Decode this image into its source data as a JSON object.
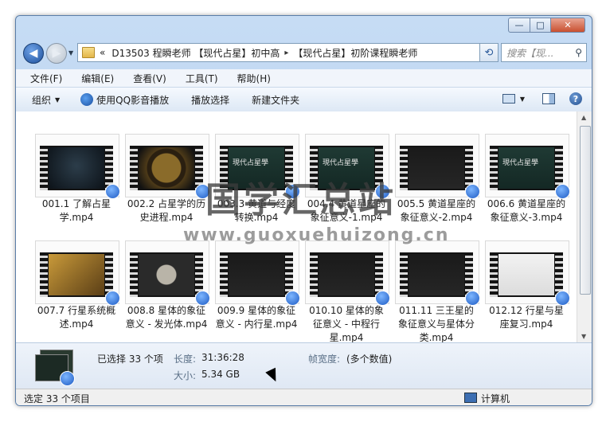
{
  "window": {
    "buttons": {
      "min": "—",
      "max": "□",
      "close": "✕"
    }
  },
  "nav": {
    "back_icon": "back-arrow-icon",
    "forward_icon": "forward-arrow-icon",
    "address": {
      "prefix": "«",
      "crumbs": [
        "D13503 程瞬老师 【现代占星】初中高",
        "【现代占星】初阶课程瞬老师"
      ],
      "sep": "▸"
    },
    "search_placeholder": "搜索【现...",
    "refresh_icon": "refresh-icon"
  },
  "menu": [
    "文件(F)",
    "编辑(E)",
    "查看(V)",
    "工具(T)",
    "帮助(H)"
  ],
  "toolbar": {
    "organize": "组织",
    "play_qq": "使用QQ影音播放",
    "play_selected": "播放选择",
    "new_folder": "新建文件夹"
  },
  "files": [
    {
      "label": "001.1 了解占星学.mp4",
      "scene": "astrology"
    },
    {
      "label": "002.2 占星学的历史进程.mp4",
      "scene": "wheel"
    },
    {
      "label": "003.3 黄道与经度转换.mp4",
      "scene": "title"
    },
    {
      "label": "004.4 黄道星座的象征意义-1.mp4",
      "scene": "title"
    },
    {
      "label": "005.5 黄道星座的象征意义-2.mp4",
      "scene": "text"
    },
    {
      "label": "006.6 黄道星座的象征意义-3.mp4",
      "scene": "title"
    },
    {
      "label": "007.7 行星系统概述.mp4",
      "scene": "planets"
    },
    {
      "label": "008.8 星体的象征意义 - 发光体.mp4",
      "scene": "moon"
    },
    {
      "label": "009.9 星体的象征意义 - 内行星.mp4",
      "scene": "text"
    },
    {
      "label": "010.10 星体的象征意义 - 中程行星.mp4",
      "scene": "text"
    },
    {
      "label": "011.11 三王星的象征意义与星体分类.mp4",
      "scene": "text"
    },
    {
      "label": "012.12 行星与星座复习.mp4",
      "scene": "symbols"
    }
  ],
  "thumb_caption": "現代占星學",
  "watermark": {
    "main": "国学汇总站",
    "sub": "www.guoxuehuizong.cn"
  },
  "details": {
    "selected": "已选择 33 个项",
    "length_label": "长度:",
    "length_value": "31:36:28",
    "size_label": "大小:",
    "size_value": "5.34 GB",
    "framewidth_label": "帧宽度:",
    "framewidth_value": "(多个数值)"
  },
  "status": {
    "left": "选定 33 个项目",
    "right": "计算机"
  }
}
